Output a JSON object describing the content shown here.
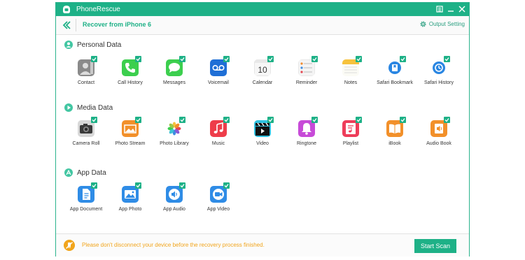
{
  "app": {
    "title": "PhoneRescue",
    "accent": "#1eb187"
  },
  "subheader": {
    "title": "Recover from iPhone 6",
    "output_setting": "Output Setting"
  },
  "sections": {
    "personal": {
      "title": "Personal Data",
      "items": [
        {
          "label": "Contact",
          "icon": "contact-icon",
          "checked": true
        },
        {
          "label": "Call History",
          "icon": "phone-icon",
          "checked": true
        },
        {
          "label": "Messages",
          "icon": "messages-icon",
          "checked": true
        },
        {
          "label": "Voicemail",
          "icon": "voicemail-icon",
          "checked": true
        },
        {
          "label": "Calendar",
          "icon": "calendar-icon",
          "checked": true,
          "day": "10"
        },
        {
          "label": "Reminder",
          "icon": "reminder-icon",
          "checked": true
        },
        {
          "label": "Notes",
          "icon": "notes-icon",
          "checked": true
        },
        {
          "label": "Safari Bookmark",
          "icon": "safari-bookmark-icon",
          "checked": true
        },
        {
          "label": "Safari History",
          "icon": "safari-history-icon",
          "checked": true
        }
      ]
    },
    "media": {
      "title": "Media Data",
      "items": [
        {
          "label": "Camera Roll",
          "icon": "camera-icon",
          "checked": true
        },
        {
          "label": "Photo Stream",
          "icon": "photo-stream-icon",
          "checked": true
        },
        {
          "label": "Photo Library",
          "icon": "photos-icon",
          "checked": true
        },
        {
          "label": "Music",
          "icon": "music-icon",
          "checked": true
        },
        {
          "label": "Video",
          "icon": "video-icon",
          "checked": true
        },
        {
          "label": "Ringtone",
          "icon": "ringtone-icon",
          "checked": true
        },
        {
          "label": "Playlist",
          "icon": "playlist-icon",
          "checked": true
        },
        {
          "label": "iBook",
          "icon": "ibook-icon",
          "checked": true
        },
        {
          "label": "Audio Book",
          "icon": "audio-book-icon",
          "checked": true
        }
      ]
    },
    "app": {
      "title": "App Data",
      "items": [
        {
          "label": "App Document",
          "icon": "app-document-icon",
          "checked": true
        },
        {
          "label": "App Photo",
          "icon": "app-photo-icon",
          "checked": true
        },
        {
          "label": "App Audio",
          "icon": "app-audio-icon",
          "checked": true
        },
        {
          "label": "App Video",
          "icon": "app-video-icon",
          "checked": true
        }
      ]
    }
  },
  "footer": {
    "warning": "Please don't disconnect your device before the recovery process finished.",
    "scan_label": "Start Scan"
  }
}
